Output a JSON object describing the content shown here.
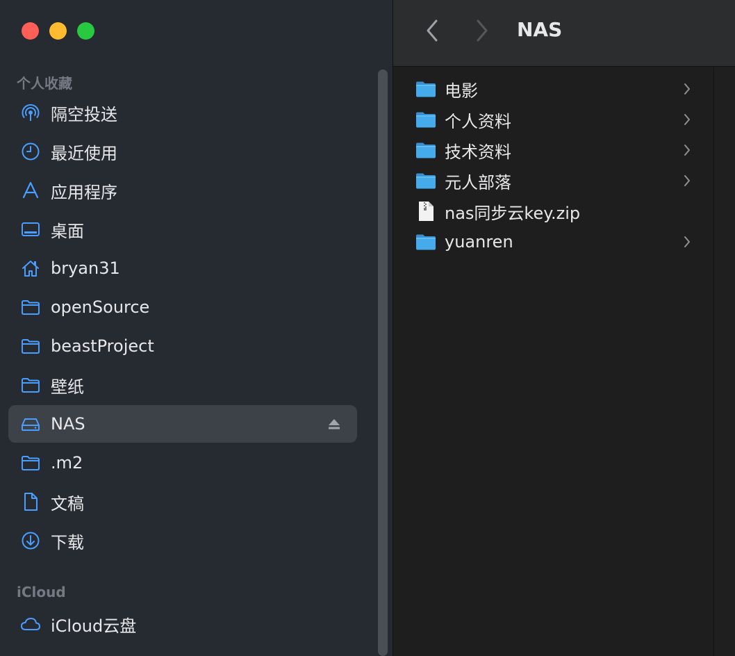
{
  "window": {
    "title": "NAS",
    "traffic_lights": {
      "close": "#fe5f57",
      "minimize": "#febc2e",
      "zoom": "#28c840"
    }
  },
  "sidebar": {
    "favorites_title": "个人收藏",
    "favorites": [
      {
        "label": "隔空投送",
        "icon": "airdrop-icon"
      },
      {
        "label": "最近使用",
        "icon": "clock-icon"
      },
      {
        "label": "应用程序",
        "icon": "applications-icon"
      },
      {
        "label": "桌面",
        "icon": "desktop-icon"
      },
      {
        "label": "bryan31",
        "icon": "home-icon"
      },
      {
        "label": "openSource",
        "icon": "folder-icon"
      },
      {
        "label": "beastProject",
        "icon": "folder-icon"
      },
      {
        "label": "壁纸",
        "icon": "folder-icon"
      },
      {
        "label": "NAS",
        "icon": "drive-icon",
        "selected": true
      },
      {
        "label": ".m2",
        "icon": "folder-icon"
      },
      {
        "label": "文稿",
        "icon": "document-icon"
      },
      {
        "label": "下载",
        "icon": "download-icon"
      }
    ],
    "icloud_title": "iCloud",
    "icloud": [
      {
        "label": "iCloud云盘",
        "icon": "cloud-icon"
      }
    ]
  },
  "files": [
    {
      "name": "电影",
      "type": "folder"
    },
    {
      "name": "个人资料",
      "type": "folder"
    },
    {
      "name": "技术资料",
      "type": "folder"
    },
    {
      "name": "元人部落",
      "type": "folder"
    },
    {
      "name": "nas同步云key.zip",
      "type": "zip"
    },
    {
      "name": "yuanren",
      "type": "folder"
    }
  ],
  "colors": {
    "accent": "#4a9eff",
    "folder": "#3ba4e8",
    "sidebar_bg": "#262a31",
    "selected_bg": "#3d4148"
  }
}
